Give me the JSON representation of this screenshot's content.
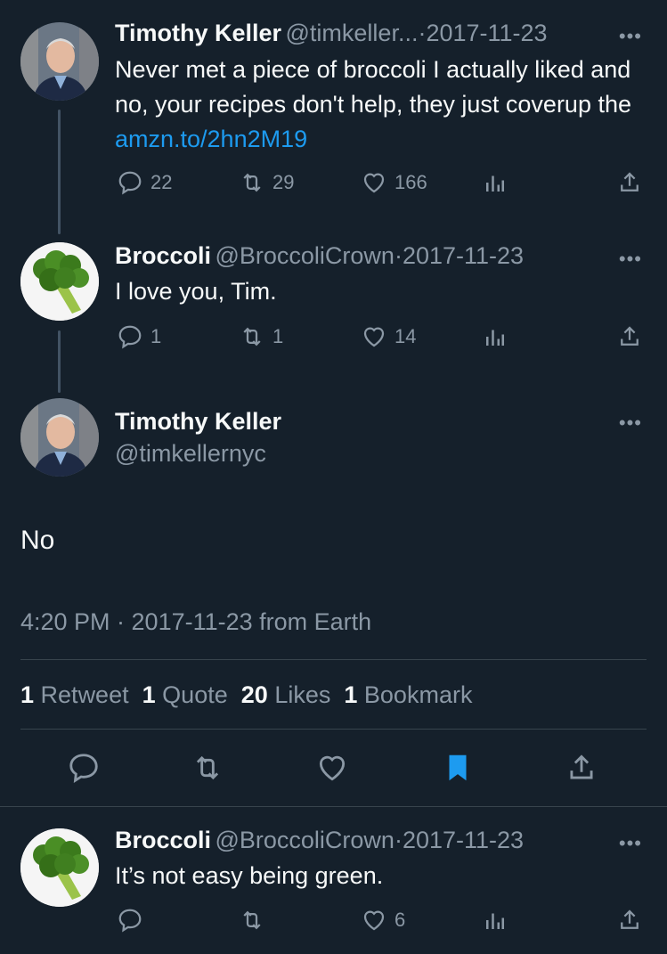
{
  "tweets": [
    {
      "name": "Timothy Keller",
      "handle": "@timkeller...",
      "date": "2017-11-23",
      "text_prefix": "Never met a piece of broccoli I actually liked and no, your recipes don't help, they just coverup the ",
      "link": "amzn.to/2hn2M19",
      "replies": "22",
      "retweets": "29",
      "likes": "166"
    },
    {
      "name": "Broccoli",
      "handle": "@BroccoliCrown",
      "date": "2017-11-23",
      "text": "I love you, Tim.",
      "replies": "1",
      "retweets": "1",
      "likes": "14"
    }
  ],
  "focus": {
    "name": "Timothy Keller",
    "handle": "@timkellernyc",
    "text": "No",
    "meta": "4:20 PM · 2017-11-23 from Earth",
    "stats": [
      {
        "num": "1",
        "label": "Retweet"
      },
      {
        "num": "1",
        "label": "Quote"
      },
      {
        "num": "20",
        "label": "Likes"
      },
      {
        "num": "1",
        "label": "Bookmark"
      }
    ]
  },
  "reply": {
    "name": "Broccoli",
    "handle": "@BroccoliCrown",
    "date": "2017-11-23",
    "text": "It’s not easy being green.",
    "likes": "6"
  },
  "sep": "·",
  "more": "•••",
  "colors": {
    "background": "#15202b",
    "link": "#1d9bf0",
    "muted": "#8b98a5",
    "bookmark": "#1d9bf0"
  }
}
